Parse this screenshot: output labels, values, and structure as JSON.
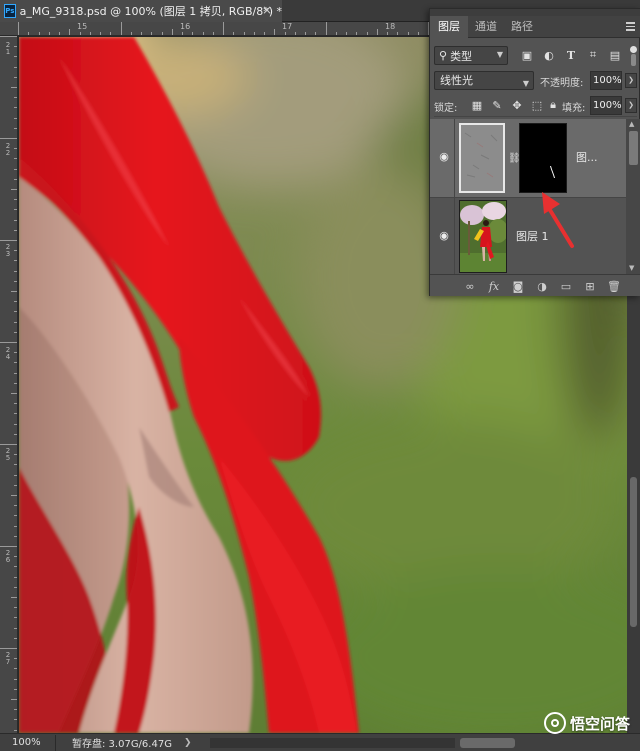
{
  "document": {
    "app_badge": "Ps",
    "title": "a_MG_9318.psd @ 100% (图层 1 拷贝, RGB/8*) *",
    "close_glyph": "×"
  },
  "rulers": {
    "top_numbers": [
      "15",
      "16",
      "17",
      "18",
      "19"
    ],
    "left_numbers": [
      "2\n1",
      "2\n2",
      "2\n3",
      "2\n4",
      "2\n5",
      "2\n6",
      "2\n7"
    ]
  },
  "layers_panel": {
    "tabs": [
      {
        "label": "图层",
        "active": true
      },
      {
        "label": "通道",
        "active": false
      },
      {
        "label": "路径",
        "active": false
      }
    ],
    "filter": {
      "kind_label": "类型",
      "kind_icon": "search-icon",
      "filter_icons": [
        "image-filter-icon",
        "adjustment-filter-icon",
        "type-filter-icon",
        "shape-filter-icon",
        "smart-object-filter-icon"
      ]
    },
    "blend_mode": "线性光",
    "opacity_label": "不透明度:",
    "opacity_value": "100%",
    "lock_label": "锁定:",
    "lock_icons": [
      "lock-transparency-icon",
      "lock-image-icon",
      "lock-position-icon",
      "lock-artboard-icon",
      "lock-all-icon"
    ],
    "fill_label": "填充:",
    "fill_value": "100%",
    "layers": [
      {
        "name": "图...",
        "visible": true,
        "selected": true,
        "has_mask": true
      },
      {
        "name": "图层 1",
        "visible": true,
        "selected": false,
        "has_mask": false
      }
    ],
    "footer_icons": [
      "link-layers-icon",
      "fx-icon",
      "add-mask-icon",
      "adjustment-layer-icon",
      "group-folder-icon",
      "new-layer-icon",
      "trash-icon"
    ],
    "fx_label": "fx"
  },
  "status_bar": {
    "zoom": "100%",
    "scratch_disk": "暂存盘: 3.07G/6.47G",
    "arrow": "❯"
  },
  "watermark": {
    "text": "悟空问答"
  },
  "colors": {
    "dress_red": "#e0141e",
    "annotation_red": "#e83030",
    "background_green": "#6f8a3e",
    "panel_bg": "#535353"
  }
}
